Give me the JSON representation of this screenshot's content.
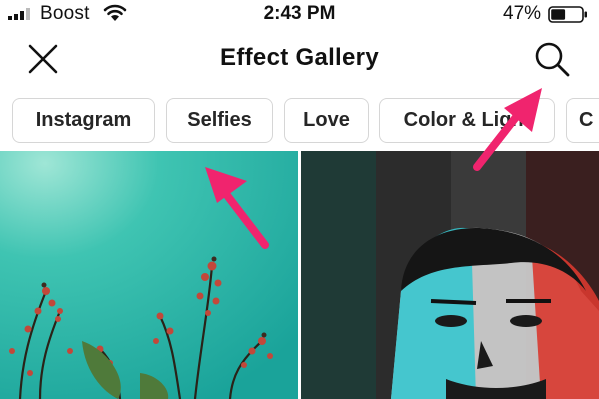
{
  "status": {
    "carrier": "Boost",
    "time": "2:43 PM",
    "battery": "47%",
    "battery_level": 0.47
  },
  "nav": {
    "title": "Effect Gallery",
    "close_icon": "close-icon",
    "search_icon": "search-icon"
  },
  "chips": [
    {
      "label": "Instagram"
    },
    {
      "label": "Selfies"
    },
    {
      "label": "Love"
    },
    {
      "label": "Color & Light"
    },
    {
      "label": "C"
    }
  ],
  "tiles": [
    {
      "name": "effect-preview-plant-sky"
    },
    {
      "name": "effect-preview-rgb-face"
    }
  ],
  "annotations": {
    "arrow_color": "#f0246e"
  },
  "colors": {
    "teal_sky": "#2fb8a8",
    "chip_border": "#d6d6d6"
  }
}
